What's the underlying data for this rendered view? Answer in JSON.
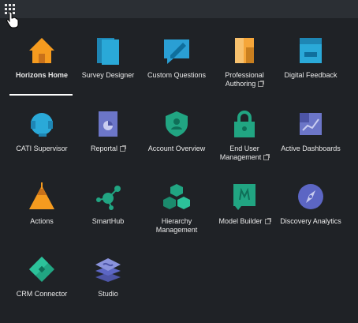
{
  "header": {
    "launcher_icon": "app-grid-icon",
    "cursor_icon": "hand-pointer-icon"
  },
  "apps": [
    {
      "label": "Horizons Home",
      "icon": "home-icon",
      "color": "#f59b1f",
      "external": false,
      "active": true
    },
    {
      "label": "Survey Designer",
      "icon": "survey-designer-icon",
      "color": "#2aa9d8",
      "external": false
    },
    {
      "label": "Custom Questions",
      "icon": "custom-questions-icon",
      "color": "#2a9fd4",
      "external": false
    },
    {
      "label": "Professional\nAuthoring",
      "icon": "professional-authoring-icon",
      "color": "#f5a63a",
      "external": true
    },
    {
      "label": "Digital Feedback",
      "icon": "digital-feedback-icon",
      "color": "#2aa9d8",
      "external": false
    },
    {
      "label": "CATI Supervisor",
      "icon": "cati-supervisor-icon",
      "color": "#2aa9d8",
      "external": false
    },
    {
      "label": "Reportal",
      "icon": "reportal-icon",
      "color": "#6c76c8",
      "external": true
    },
    {
      "label": "Account Overview",
      "icon": "account-overview-icon",
      "color": "#21a582",
      "external": false
    },
    {
      "label": "End User\nManagement",
      "icon": "end-user-management-icon",
      "color": "#21a582",
      "external": true
    },
    {
      "label": "Active Dashboards",
      "icon": "active-dashboards-icon",
      "color": "#6c76c8",
      "external": false
    },
    {
      "label": "Actions",
      "icon": "actions-icon",
      "color": "#f59b1f",
      "external": false
    },
    {
      "label": "SmartHub",
      "icon": "smarthub-icon",
      "color": "#21a582",
      "external": false
    },
    {
      "label": "Hierarchy\nManagement",
      "icon": "hierarchy-management-icon",
      "color": "#21a582",
      "external": false
    },
    {
      "label": "Model Builder",
      "icon": "model-builder-icon",
      "color": "#21a582",
      "external": true
    },
    {
      "label": "Discovery Analytics",
      "icon": "discovery-analytics-icon",
      "color": "#5c66c4",
      "external": false
    },
    {
      "label": "CRM Connector",
      "icon": "crm-connector-icon",
      "color": "#21a582",
      "external": false
    },
    {
      "label": "Studio",
      "icon": "studio-icon",
      "color": "#6c76c8",
      "external": false
    }
  ]
}
